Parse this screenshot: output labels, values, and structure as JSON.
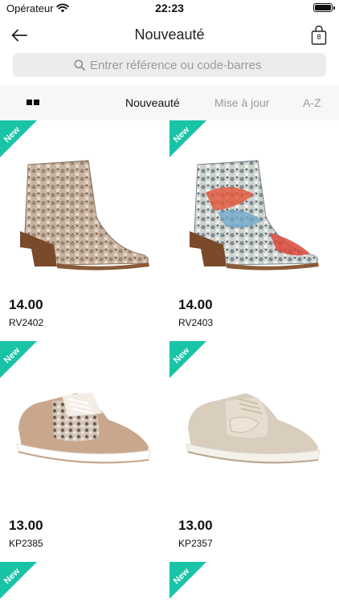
{
  "status_bar": {
    "carrier": "Opérateur",
    "time": "22:23"
  },
  "nav": {
    "title": "Nouveauté",
    "bag_count": "8"
  },
  "search": {
    "placeholder": "Entrer référence ou code-barres"
  },
  "sort_tabs": [
    {
      "label": "Nouveauté",
      "active": true
    },
    {
      "label": "Mise à jour",
      "active": false
    },
    {
      "label": "A-Z",
      "active": false
    }
  ],
  "products": [
    {
      "badge": "New",
      "price": "14.00",
      "ref": "RV2402",
      "image_icon": "snakeskin-ankle-boot-beige"
    },
    {
      "badge": "New",
      "price": "14.00",
      "ref": "RV2403",
      "image_icon": "snakeskin-ankle-boot-multicolor"
    },
    {
      "badge": "New",
      "price": "13.00",
      "ref": "KP2385",
      "image_icon": "snakeskin-sneaker-beige"
    },
    {
      "badge": "New",
      "price": "13.00",
      "ref": "KP2357",
      "image_icon": "mesh-sneaker-beige"
    },
    {
      "badge": "New"
    },
    {
      "badge": "New"
    }
  ],
  "colors": {
    "accent": "#19c3a6",
    "search_bg": "#ececec",
    "toolbar_bg": "#f7f7f7",
    "inactive_tab": "#9a9a9a"
  }
}
